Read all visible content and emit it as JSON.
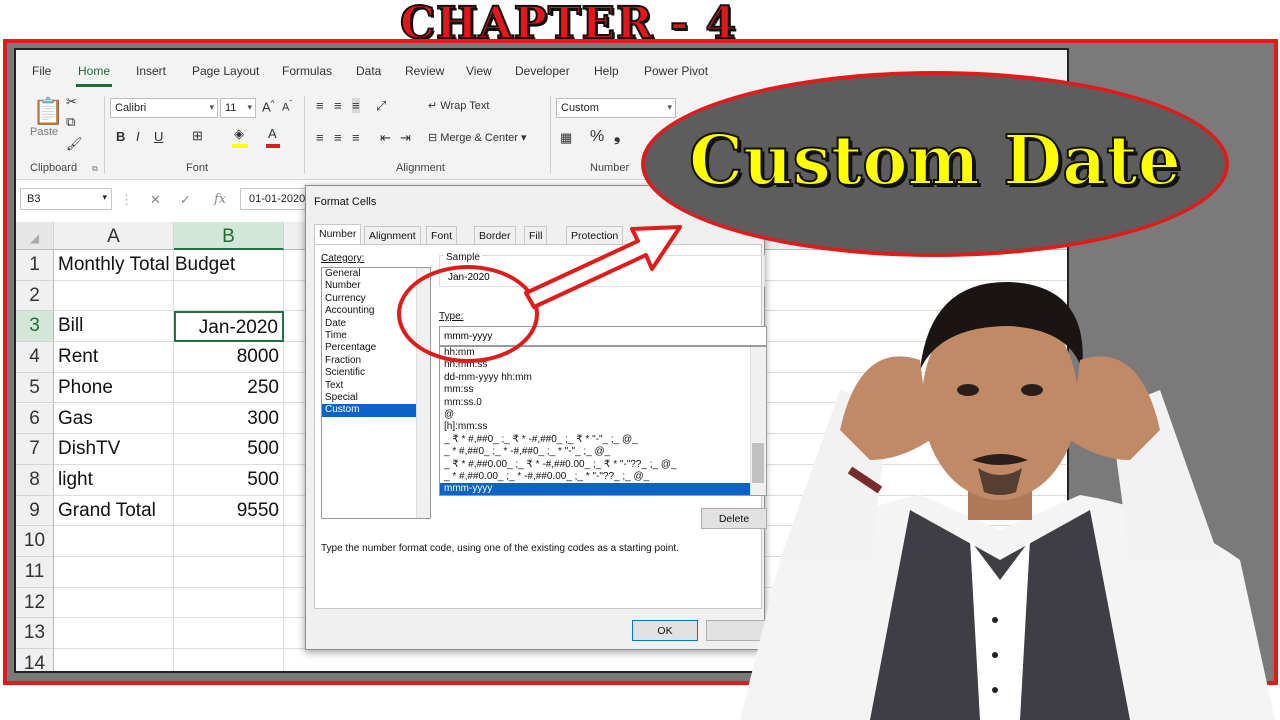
{
  "thumbnail": {
    "chapter": "CHAPTER - 4",
    "callout": "Custom Date"
  },
  "menu": [
    "File",
    "Home",
    "Insert",
    "Page Layout",
    "Formulas",
    "Data",
    "Review",
    "View",
    "Developer",
    "Help",
    "Power Pivot"
  ],
  "ribbon": {
    "font_name": "Calibri",
    "font_size": "11",
    "bold": "B",
    "italic": "I",
    "underline": "U",
    "wrap_text": "Wrap Text",
    "merge_center": "Merge & Center",
    "number_format": "Custom",
    "percent": "%",
    "comma": "❟",
    "paste": "Paste",
    "group_clipboard": "Clipboard",
    "group_font": "Font",
    "group_alignment": "Alignment",
    "group_number": "Number"
  },
  "formula_bar": {
    "name_box": "B3",
    "content": "01-01-2020"
  },
  "sheet": {
    "columns": [
      "A",
      "B"
    ],
    "rows": [
      {
        "n": "1",
        "a": "Monthly Total Budget",
        "b": ""
      },
      {
        "n": "2",
        "a": "",
        "b": ""
      },
      {
        "n": "3",
        "a": "Bill",
        "b": "Jan-2020"
      },
      {
        "n": "4",
        "a": "Rent",
        "b": "8000"
      },
      {
        "n": "5",
        "a": "Phone",
        "b": "250"
      },
      {
        "n": "6",
        "a": "Gas",
        "b": "300"
      },
      {
        "n": "7",
        "a": "DishTV",
        "b": "500"
      },
      {
        "n": "8",
        "a": "light",
        "b": "500"
      },
      {
        "n": "9",
        "a": "Grand Total",
        "b": "9550"
      },
      {
        "n": "10",
        "a": "",
        "b": ""
      },
      {
        "n": "11",
        "a": "",
        "b": ""
      },
      {
        "n": "12",
        "a": "",
        "b": ""
      },
      {
        "n": "13",
        "a": "",
        "b": ""
      },
      {
        "n": "14",
        "a": "",
        "b": ""
      }
    ]
  },
  "dialog": {
    "title": "Format Cells",
    "tabs": [
      "Number",
      "Alignment",
      "Font",
      "Border",
      "Fill",
      "Protection"
    ],
    "category_label": "Category:",
    "categories": [
      "General",
      "Number",
      "Currency",
      "Accounting",
      "Date",
      "Time",
      "Percentage",
      "Fraction",
      "Scientific",
      "Text",
      "Special",
      "Custom"
    ],
    "selected_category": "Custom",
    "sample_label": "Sample",
    "sample_value": "Jan-2020",
    "type_label": "Type:",
    "type_value": "mmm-yyyy",
    "formats": [
      "hh:mm",
      "hh:mm:ss",
      "dd-mm-yyyy hh:mm",
      "mm:ss",
      "mm:ss.0",
      "@",
      "[h]:mm:ss",
      "_ ₹ * #,##0_ ;_ ₹ * -#,##0_ ;_ ₹ * \"-\"_ ;_ @_",
      "_ * #,##0_ ;_ * -#,##0_ ;_ * \"-\"_ ;_ @_",
      "_ ₹ * #,##0.00_ ;_ ₹ * -#,##0.00_ ;_ ₹ * \"-\"??_ ;_ @_",
      "_ * #,##0.00_ ;_ * -#,##0.00_ ;_ * \"-\"??_ ;_ @_",
      "mmm-yyyy"
    ],
    "selected_format": "mmm-yyyy",
    "delete_button": "Delete",
    "hint": "Type the number format code, using one of the existing codes as a starting point.",
    "ok_button": "OK"
  },
  "colors": {
    "frame_red": "#e01b1b",
    "excel_green": "#217346",
    "callout_yellow": "#ffff00",
    "selection_blue": "#0a64c8"
  }
}
